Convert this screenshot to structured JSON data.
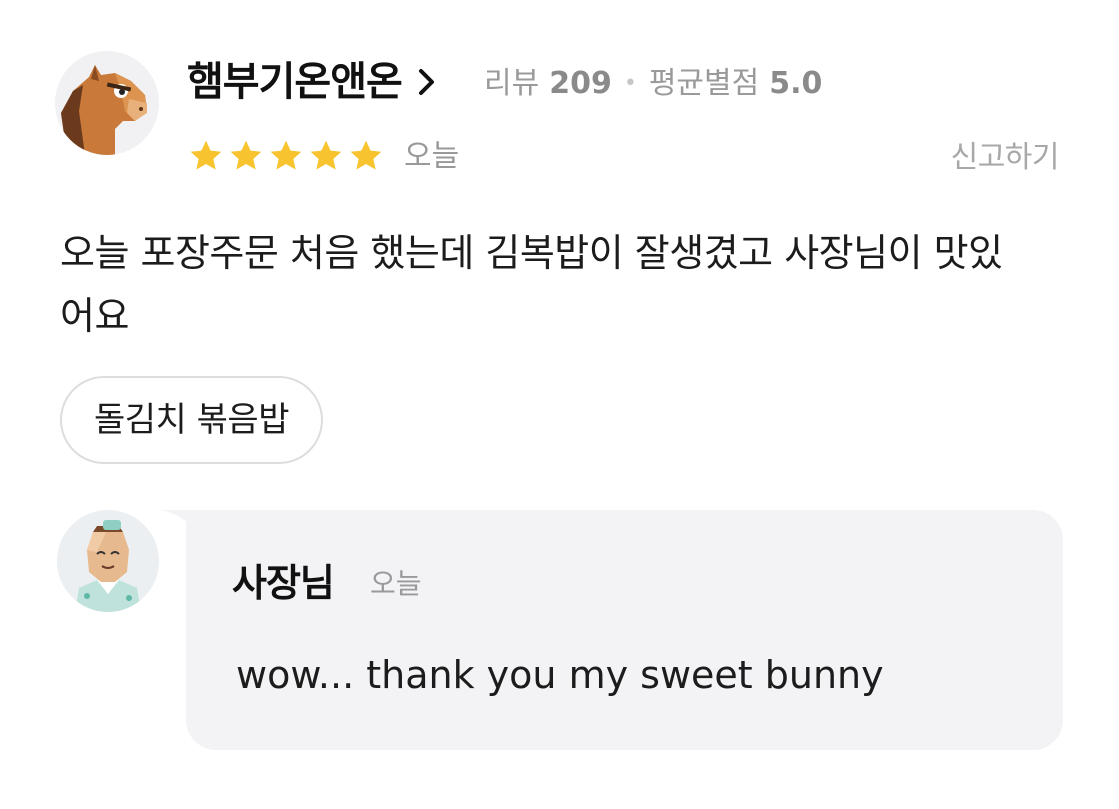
{
  "review": {
    "reviewer_name": "햄부기온앤온",
    "review_label": "리뷰",
    "review_count": "209",
    "rating_label": "평균별점",
    "rating_avg": "5.0",
    "stars": 5,
    "date": "오늘",
    "report_label": "신고하기",
    "text": "오늘 포장주문 처음 했는데 김복밥이 잘생겼고 사장님이 맛있어요",
    "menu_tag": "돌김치 볶음밥"
  },
  "reply": {
    "owner_name": "사장님",
    "date": "오늘",
    "text": "wow... thank you my sweet bunny"
  },
  "colors": {
    "star": "#f7c32e",
    "bubble": "#f3f3f6",
    "muted_text": "#999999"
  },
  "icons": {
    "reviewer_avatar": "horse-avatar-icon",
    "owner_avatar": "chef-avatar-icon",
    "chevron": "chevron-right-icon",
    "star": "star-icon"
  }
}
